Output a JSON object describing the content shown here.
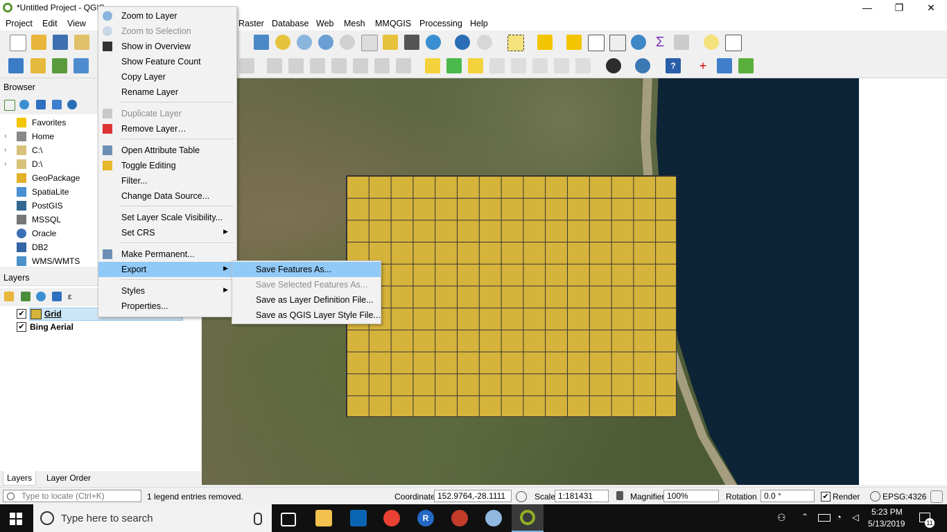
{
  "window": {
    "title": "*Untitled Project - QGIS",
    "minimize": "—",
    "restore": "❐",
    "close": "✕"
  },
  "menubar": [
    "Project",
    "Edit",
    "View",
    "Raster",
    "Database",
    "Web",
    "Mesh",
    "MMQGIS",
    "Processing",
    "Help"
  ],
  "browser": {
    "title": "Browser",
    "items": [
      {
        "label": "Favorites",
        "icon": "star-icon",
        "expandable": false
      },
      {
        "label": "Home",
        "icon": "home-folder-icon",
        "expandable": true
      },
      {
        "label": "C:\\",
        "icon": "folder-icon",
        "expandable": true
      },
      {
        "label": "D:\\",
        "icon": "folder-icon",
        "expandable": true
      },
      {
        "label": "GeoPackage",
        "icon": "geopackage-icon",
        "expandable": false
      },
      {
        "label": "SpatiaLite",
        "icon": "spatialite-icon",
        "expandable": false
      },
      {
        "label": "PostGIS",
        "icon": "postgis-icon",
        "expandable": false
      },
      {
        "label": "MSSQL",
        "icon": "mssql-icon",
        "expandable": false
      },
      {
        "label": "Oracle",
        "icon": "oracle-icon",
        "expandable": false
      },
      {
        "label": "DB2",
        "icon": "db2-icon",
        "expandable": false
      },
      {
        "label": "WMS/WMTS",
        "icon": "wms-icon",
        "expandable": false
      }
    ]
  },
  "layers": {
    "title": "Layers",
    "items": [
      {
        "label": "Grid",
        "checked": "✔",
        "selected": true
      },
      {
        "label": "Bing Aerial",
        "checked": "✔",
        "selected": false
      }
    ],
    "tabs": [
      "Layers",
      "Layer Order"
    ]
  },
  "context_menu": {
    "items": [
      {
        "label": "Zoom to Layer",
        "icon": "zoom-to-layer-icon",
        "disabled": false
      },
      {
        "label": "Zoom to Selection",
        "icon": "zoom-to-selection-icon",
        "disabled": true
      },
      {
        "label": "Show in Overview",
        "icon": "overview-icon",
        "disabled": false
      },
      {
        "label": "Show Feature Count",
        "icon": "",
        "disabled": false
      },
      {
        "label": "Copy Layer",
        "icon": "",
        "disabled": false
      },
      {
        "label": "Rename Layer",
        "icon": "",
        "disabled": false
      },
      {
        "label": "Duplicate Layer",
        "icon": "duplicate-icon",
        "disabled": true
      },
      {
        "label": "Remove Layer…",
        "icon": "remove-layer-icon",
        "disabled": false
      },
      {
        "label": "Open Attribute Table",
        "icon": "attribute-table-icon",
        "disabled": false
      },
      {
        "label": "Toggle Editing",
        "icon": "pencil-icon",
        "disabled": false
      },
      {
        "label": "Filter...",
        "icon": "",
        "disabled": false
      },
      {
        "label": "Change Data Source...",
        "icon": "",
        "disabled": false
      },
      {
        "label": "Set Layer Scale Visibility...",
        "icon": "",
        "disabled": false
      },
      {
        "label": "Set CRS",
        "icon": "",
        "disabled": false,
        "submenu": true
      },
      {
        "label": "Make Permanent...",
        "icon": "save-icon",
        "disabled": false
      },
      {
        "label": "Export",
        "icon": "",
        "disabled": false,
        "submenu": true,
        "highlighted": true
      },
      {
        "label": "Styles",
        "icon": "",
        "disabled": false,
        "submenu": true
      },
      {
        "label": "Properties...",
        "icon": "",
        "disabled": false
      }
    ],
    "submenu_arrow": "▶"
  },
  "export_submenu": [
    {
      "label": "Save Features As...",
      "disabled": false,
      "highlighted": true
    },
    {
      "label": "Save Selected Features As...",
      "disabled": true
    },
    {
      "label": "Save as Layer Definition File...",
      "disabled": false
    },
    {
      "label": "Save as QGIS Layer Style File...",
      "disabled": false
    }
  ],
  "statusbar": {
    "locate_placeholder": "Type to locate (Ctrl+K)",
    "message": "1 legend entries removed.",
    "coordinate_label": "Coordinate",
    "coordinate_value": "152.9764,-28.1111",
    "scale_label": "Scale",
    "scale_value": "1:181431",
    "magnifier_label": "Magnifier",
    "magnifier_value": "100%",
    "rotation_label": "Rotation",
    "rotation_value": "0.0 °",
    "render_label": "Render",
    "render_checked": "✔",
    "crs": "EPSG:4326"
  },
  "taskbar": {
    "search_placeholder": "Type here to search",
    "time": "5:23 PM",
    "date": "5/13/2019",
    "notifications": "11"
  },
  "colors": {
    "grid_fill": "#d6b33b",
    "menu_highlight": "#91c9f7",
    "sea": "#0d2336",
    "qgis_green": "#589632"
  }
}
